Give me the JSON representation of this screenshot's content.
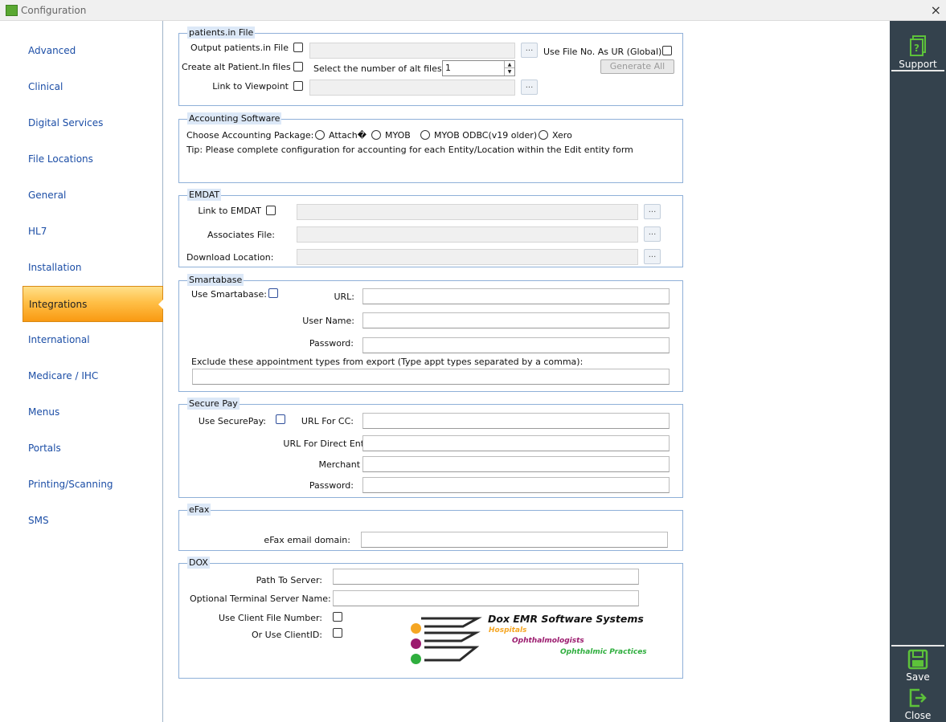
{
  "window": {
    "title": "Configuration",
    "close_glyph": "×"
  },
  "sidebar": {
    "items": [
      {
        "label": "Advanced"
      },
      {
        "label": "Clinical"
      },
      {
        "label": "Digital Services"
      },
      {
        "label": "File Locations"
      },
      {
        "label": "General"
      },
      {
        "label": "HL7"
      },
      {
        "label": "Installation"
      },
      {
        "label": "Integrations"
      },
      {
        "label": "International"
      },
      {
        "label": "Medicare / IHC"
      },
      {
        "label": "Menus"
      },
      {
        "label": "Portals"
      },
      {
        "label": "Printing/Scanning"
      },
      {
        "label": "SMS"
      }
    ],
    "active": "Integrations"
  },
  "rightbar": {
    "support": "Support",
    "save": "Save",
    "close": "Close"
  },
  "patients_in": {
    "legend": "patients.in File",
    "output_label": "Output patients.in File",
    "alt_files_label": "Create alt Patient.In files",
    "viewpoint_label": "Link to Viewpoint",
    "use_file_no_label": "Use File No. As UR (Global):",
    "alt_count_label": "Select the number of alt files:",
    "alt_count_value": "1",
    "generate_all": "Generate All",
    "browse": "..."
  },
  "accounting": {
    "legend": "Accounting Software",
    "choose_label": "Choose Accounting Package:",
    "options": [
      "Attach�",
      "MYOB",
      "MYOB ODBC(v19 older)",
      "Xero"
    ],
    "tip": "Tip: Please complete configuration for accounting for each Entity/Location within the Edit entity form"
  },
  "emdat": {
    "legend": "EMDAT",
    "link_label": "Link to EMDAT",
    "associates_label": "Associates File:",
    "download_label": "Download Location:"
  },
  "smartabase": {
    "legend": "Smartabase",
    "use_label": "Use Smartabase:",
    "url_label": "URL:",
    "username_label": "User Name:",
    "password_label": "Password:",
    "exclude_label": "Exclude these appointment types from export (Type appt types separated by a comma):"
  },
  "securepay": {
    "legend": "Secure Pay",
    "use_label": "Use SecurePay:",
    "url_cc_label": "URL For CC:",
    "url_direct_label": "URL For Direct Entry:",
    "merchant_label": "Merchant ID:",
    "password_label": "Password:"
  },
  "efax": {
    "legend": "eFax",
    "domain_label": "eFax email domain:"
  },
  "dox": {
    "legend": "DOX",
    "path_label": "Path To Server:",
    "terminal_label": "Optional Terminal Server Name:",
    "client_file_label": "Use Client File Number:",
    "client_id_label": "Or Use ClientID:",
    "logo": {
      "title": "Dox EMR Software Systems",
      "line1": "Hospitals",
      "line2": "Ophthalmologists",
      "line3": "Ophthalmic Practices",
      "colors": {
        "orange": "#f5a623",
        "purple": "#9b1b6e",
        "green": "#2fae3e"
      }
    }
  }
}
